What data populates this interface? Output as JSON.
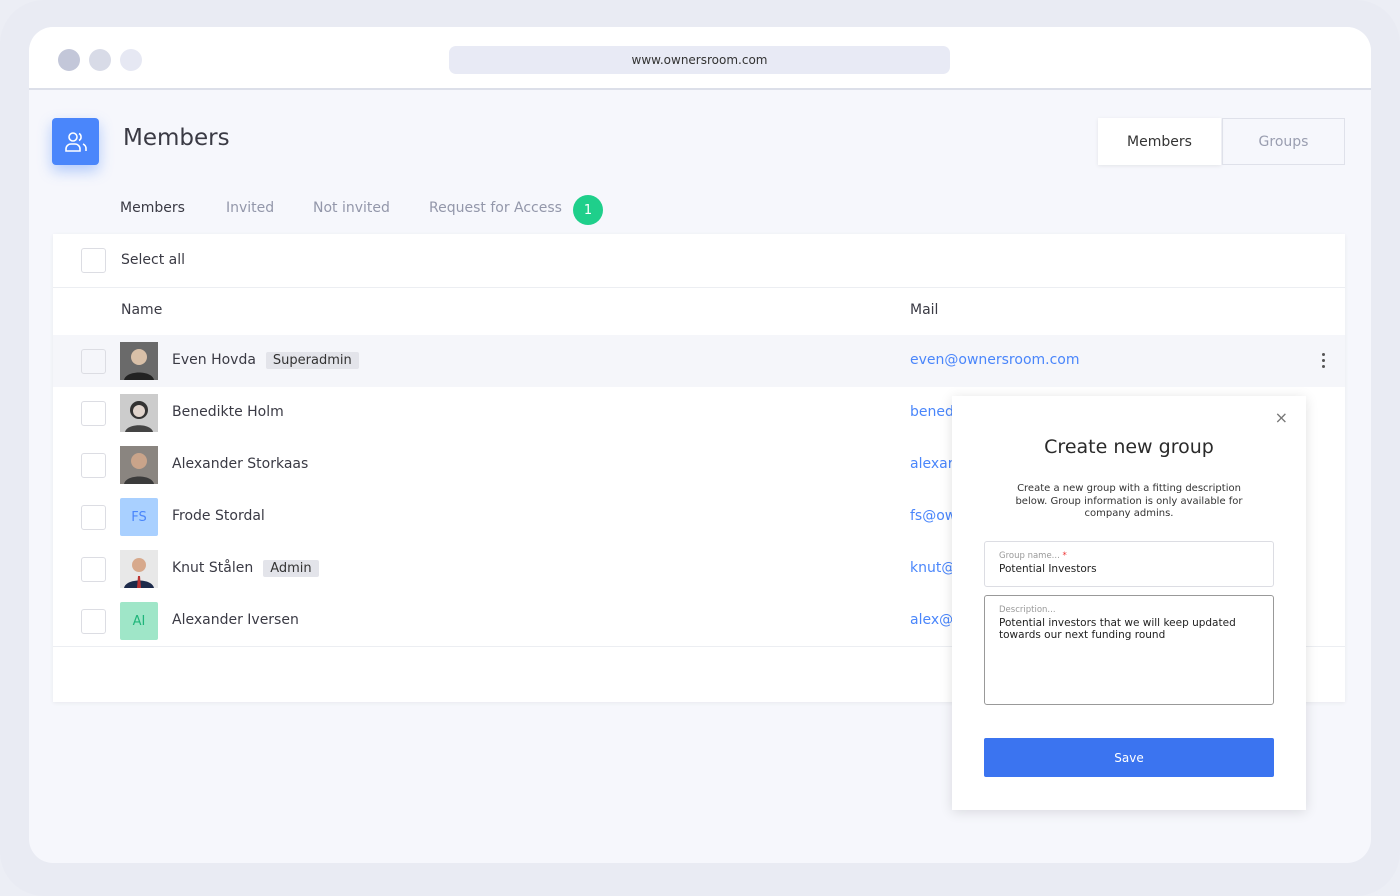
{
  "browser": {
    "url": "www.ownersroom.com"
  },
  "header": {
    "title": "Members",
    "icon": "users-icon",
    "segments": [
      {
        "label": "Members",
        "active": true
      },
      {
        "label": "Groups",
        "active": false
      }
    ]
  },
  "tabs": [
    {
      "label": "Members",
      "active": true
    },
    {
      "label": "Invited"
    },
    {
      "label": "Not invited"
    },
    {
      "label": "Request for Access",
      "badge": "1"
    }
  ],
  "table": {
    "select_all": "Select all",
    "columns": [
      "Name",
      "Mail"
    ],
    "rows": [
      {
        "name": "Even Hovda",
        "role": "Superadmin",
        "mail": "even@ownersroom.com",
        "avatar": "photo",
        "highlighted": true
      },
      {
        "name": "Benedikte Holm",
        "role": "",
        "mail": "bened",
        "avatar": "photo"
      },
      {
        "name": "Alexander Storkaas",
        "role": "",
        "mail": "alexar",
        "avatar": "photo"
      },
      {
        "name": "Frode Stordal",
        "role": "",
        "mail": "fs@ow",
        "avatar": "FS",
        "avatar_color": "#a9d0ff"
      },
      {
        "name": "Knut Stålen",
        "role": "Admin",
        "mail": "knut@",
        "avatar": "photo"
      },
      {
        "name": "Alexander Iversen",
        "role": "",
        "mail": "alex@",
        "avatar": "AI",
        "avatar_color": "#9fe6c8"
      }
    ]
  },
  "modal": {
    "title": "Create new group",
    "description": "Create a new group with a fitting description below. Group information is only available for company admins.",
    "group_name_label": "Group name...",
    "required_mark": "*",
    "group_name_value": "Potential Investors",
    "description_label": "Description...",
    "description_value": "Potential investors that we will keep updated towards our next funding round",
    "save": "Save"
  },
  "colors": {
    "accent": "#4a86fb",
    "badge": "#1fcf8b",
    "save": "#3b74f0"
  }
}
